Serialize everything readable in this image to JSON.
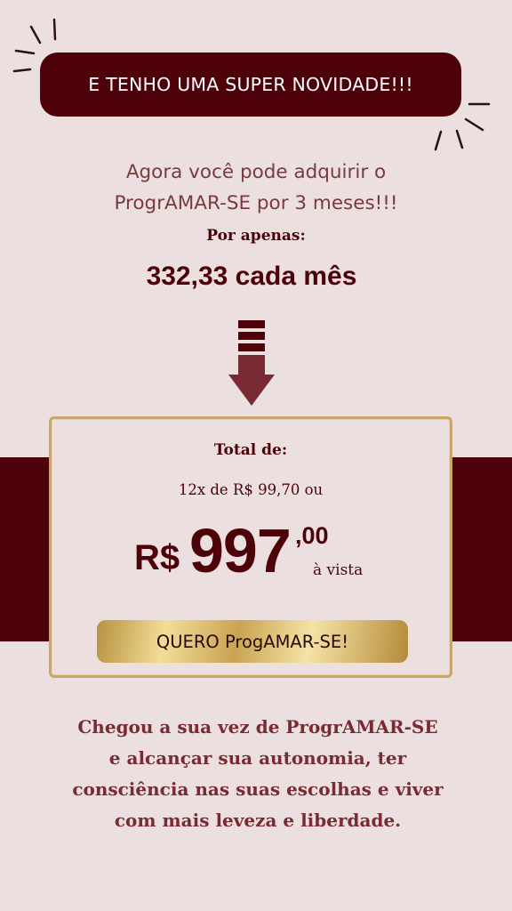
{
  "banner": {
    "text": "E TENHO UMA SUPER NOVIDADE!!!"
  },
  "intro": {
    "line1": "Agora você pode adquirir o",
    "line2": "ProgrAMAR-SE por 3 meses!!!"
  },
  "por_apenas": "Por apenas:",
  "monthly_price": "332,33 cada mês",
  "offer": {
    "total_label": "Total de:",
    "installments": "12x de R$ 99,70 ou",
    "currency": "R$",
    "amount": "997",
    "cents": ",00",
    "note": "à vista",
    "cta_label": "QUERO ProgAMAR-SE!"
  },
  "closing": {
    "line1": "Chegou a sua vez de ProgrAMAR-SE",
    "line2": "e alcançar sua autonomia, ter",
    "line3": "consciência nas suas escolhas e viver",
    "line4": "com mais leveza e liberdade."
  },
  "colors": {
    "background": "#ebe0df",
    "brand_dark": "#4d0209",
    "text_muted": "#7a3a3e",
    "arrow": "#7a2a32",
    "gold": "#c9a66b"
  },
  "icons": {
    "sparkle_left": "sparkle-lines-icon",
    "sparkle_right": "sparkle-lines-icon",
    "arrow": "down-arrow-icon"
  }
}
